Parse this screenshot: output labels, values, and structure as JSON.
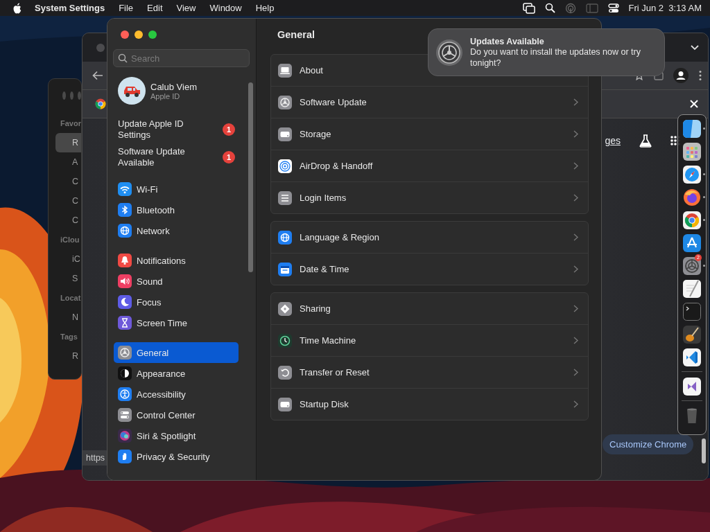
{
  "menu_bar": {
    "app": "System Settings",
    "menus": [
      "File",
      "Edit",
      "View",
      "Window",
      "Help"
    ],
    "clock": "Fri Jun 2  3:13 AM"
  },
  "finder": {
    "items": [
      {
        "kind": "heading",
        "label": "Favor"
      },
      {
        "kind": "item",
        "label": "R",
        "selected": true
      },
      {
        "kind": "item",
        "label": "A",
        "selected": false
      },
      {
        "kind": "item",
        "label": "C",
        "selected": false
      },
      {
        "kind": "item",
        "label": "C",
        "selected": false
      },
      {
        "kind": "item",
        "label": "C",
        "selected": false
      },
      {
        "kind": "heading",
        "label": "iClou"
      },
      {
        "kind": "item",
        "label": "iC",
        "selected": false
      },
      {
        "kind": "item",
        "label": "S",
        "selected": false
      },
      {
        "kind": "heading",
        "label": "Locat"
      },
      {
        "kind": "item",
        "label": "N",
        "selected": false
      },
      {
        "kind": "heading",
        "label": "Tags"
      },
      {
        "kind": "item",
        "label": "R",
        "selected": false
      }
    ]
  },
  "chrome": {
    "link": "ges",
    "customize_button": "Customize Chrome",
    "status_url": "https"
  },
  "settings": {
    "search": {
      "placeholder": "Search"
    },
    "account": {
      "name": "Calub Viem",
      "subtitle": "Apple ID"
    },
    "alerts": [
      {
        "label": "Update Apple ID Settings",
        "badge": "1"
      },
      {
        "label": "Software Update Available",
        "badge": "1"
      }
    ],
    "sidebar": [
      [
        {
          "label": "Wi-Fi",
          "selected": false
        },
        {
          "label": "Bluetooth",
          "selected": false
        },
        {
          "label": "Network",
          "selected": false
        }
      ],
      [
        {
          "label": "Notifications",
          "selected": false
        },
        {
          "label": "Sound",
          "selected": false
        },
        {
          "label": "Focus",
          "selected": false
        },
        {
          "label": "Screen Time",
          "selected": false
        }
      ],
      [
        {
          "label": "General",
          "selected": true
        },
        {
          "label": "Appearance",
          "selected": false
        },
        {
          "label": "Accessibility",
          "selected": false
        },
        {
          "label": "Control Center",
          "selected": false
        },
        {
          "label": "Siri & Spotlight",
          "selected": false
        },
        {
          "label": "Privacy & Security",
          "selected": false
        }
      ]
    ],
    "content": {
      "title": "General",
      "groups": [
        [
          {
            "label": "About",
            "chevron": false
          },
          {
            "label": "Software Update",
            "chevron": true
          },
          {
            "label": "Storage",
            "chevron": true
          },
          {
            "label": "AirDrop & Handoff",
            "chevron": true
          },
          {
            "label": "Login Items",
            "chevron": true
          }
        ],
        [
          {
            "label": "Language & Region",
            "chevron": true
          },
          {
            "label": "Date & Time",
            "chevron": true
          }
        ],
        [
          {
            "label": "Sharing",
            "chevron": true
          },
          {
            "label": "Time Machine",
            "chevron": true
          },
          {
            "label": "Transfer or Reset",
            "chevron": true
          },
          {
            "label": "Startup Disk",
            "chevron": true
          }
        ]
      ]
    }
  },
  "notification": {
    "title": "Updates Available",
    "body": "Do you want to install the updates now or try tonight?"
  },
  "dock": {
    "sections": [
      [
        {
          "running": true
        },
        {
          "running": false
        },
        {
          "running": true
        },
        {
          "running": true
        },
        {
          "running": true
        },
        {
          "running": false
        },
        {
          "running": true,
          "badge": "2"
        },
        {
          "running": false
        },
        {
          "running": false
        },
        {
          "running": false
        },
        {
          "running": false
        }
      ],
      [
        {
          "running": false
        }
      ],
      [
        {
          "running": false
        }
      ]
    ]
  }
}
